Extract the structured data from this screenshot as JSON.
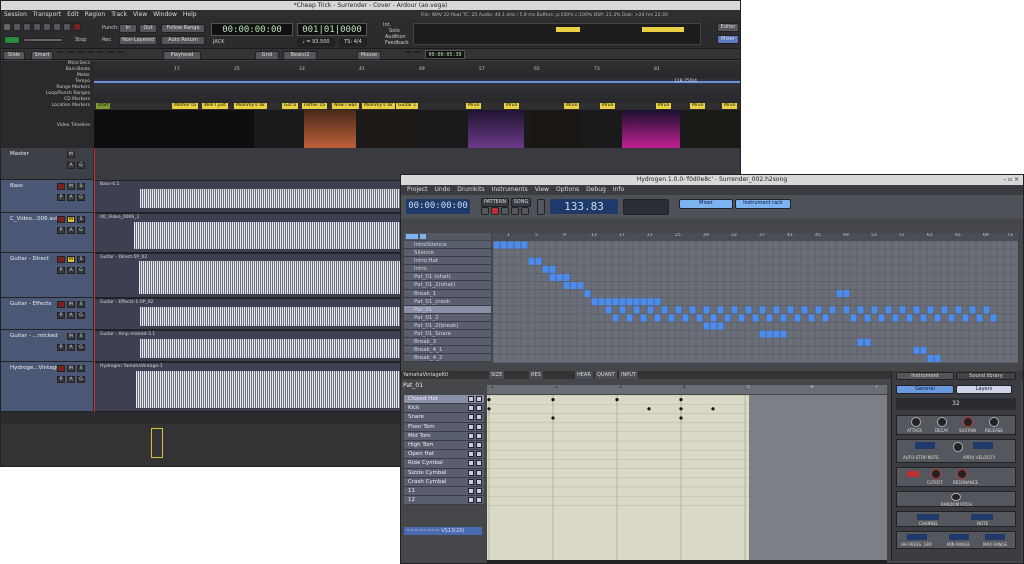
{
  "ardour": {
    "title": "*Cheap Trick - Surrender - Cover - Ardour (ao.vega)",
    "menu": [
      "Session",
      "Transport",
      "Edit",
      "Region",
      "Track",
      "View",
      "Window",
      "Help"
    ],
    "transport": {
      "punch_label": "Punch:",
      "in": "In",
      "out": "Out",
      "follow_range": "Follow Range",
      "auto_return": "Auto Return",
      "stop": "Stop",
      "rec": "Rec",
      "non_layered": "Non-Layered",
      "primary_clock": "00:00:00:00",
      "secondary_clock": "001|01|0000",
      "jack": "JACK",
      "tempo": "♩ = 93.500",
      "ts": "TS: 4/4",
      "int": "Int.",
      "solo": "Solo",
      "audition": "Audition",
      "feedback": "Feedback",
      "editor": "Editor",
      "mixer": "Mixer",
      "mini_clock": "00:00:05:30",
      "status": "File: WAV 32-float   TC: 25   Audio: 44.1 kHz / 5.8 ms   Buffers: p:100% c:100%   DSP: 21.3%   Disk: >24 hrs   22:30"
    },
    "edit_bar": {
      "slide": "Slide",
      "smart": "Smart",
      "playhead": "Playhead",
      "grid": "Grid",
      "beats": "Beats/2",
      "mouse": "Mouse"
    },
    "ruler_labels": [
      "Mins:Secs",
      "Bars:Beats",
      "Meter",
      "Tempo",
      "Range Markers",
      "Loop/Punch Ranges",
      "CD Markers",
      "Location Markers"
    ],
    "video_label": "Video Timeline",
    "tempo_marker": "118.750/4",
    "bar_numbers": [
      "17",
      "25",
      "33",
      "41",
      "49",
      "57",
      "65",
      "73",
      "81"
    ],
    "location_markers": [
      "start",
      "Mother ta",
      "Well I just",
      "Mommy's alr",
      "Got b",
      "Father ca",
      "Now I was",
      "Mommy's alr",
      "Guitar 1",
      "Mrun",
      "Mrun",
      "Mrun",
      "Mrun",
      "Mrun",
      "Mrun",
      "Mrun"
    ],
    "tracks": [
      {
        "name": "Master",
        "region": ""
      },
      {
        "name": "Bass",
        "region": "Bass-4.1"
      },
      {
        "name": "C_Video...006.avi",
        "region": "00_Video_0006_1"
      },
      {
        "name": "Guitar - Direct",
        "region": "Guitar - Direct-5P_02"
      },
      {
        "name": "Guitar - Effects",
        "region": "Guitar - Effects-1-0P_02"
      },
      {
        "name": "Guitar - ...micked",
        "region": "Guitar - Amp micked-3.1"
      },
      {
        "name": "Hydroge...Vintage",
        "region": "Hydrogen YamahaVintage-1"
      }
    ]
  },
  "hydrogen": {
    "title": "Hydrogen 1.0.0-'f0d0e8c' - Surrender_002.h2song",
    "menu": [
      "Project",
      "Undo",
      "Drumkits",
      "Instruments",
      "View",
      "Options",
      "Debug",
      "Info"
    ],
    "clock": "00:00:00:00",
    "bpm": "133.83",
    "mixer": "Mixer",
    "instrument_rack": "Instrument rack",
    "pattern_mode": "PATTERN",
    "song_mode": "SONG",
    "song_patterns": [
      "IntroSilence",
      "Silence",
      "Intro.Hat",
      "Intro",
      "Pat_01 (ohat)",
      "Pat_01_2(ohat)",
      "Break_1",
      "Pat_01_crash",
      "Pat_01",
      "Pat_01_2",
      "Pat_01_2(break)",
      "Pat_01_Snare",
      "Break_3",
      "Break_4_1",
      "Break_4_2"
    ],
    "timeline_numbers": [
      "1",
      "5",
      "9",
      "13",
      "17",
      "21",
      "25",
      "29",
      "33",
      "37",
      "41",
      "45",
      "49",
      "53",
      "57",
      "61",
      "65",
      "69",
      "73"
    ],
    "drumkit": "YamahaVintageKit",
    "pattern_name": "Pat_01",
    "pattern_opts": {
      "size": "SIZE",
      "res": "RES",
      "hear": "HEAR",
      "quant": "QUANT",
      "input": "INPUT"
    },
    "instruments": [
      "Closed Hat",
      "Kick",
      "Snare",
      "Floor Tom",
      "Mid Tom",
      "High Tom",
      "Open Hat",
      "Ride Cymbal",
      "Sizzle Cymbal",
      "Crash Cymbal",
      "11",
      "12"
    ],
    "pattern_beats": [
      "1",
      "2",
      "3",
      "4",
      "5",
      "6",
      "7"
    ],
    "sidebar": {
      "instrument_tab": "Instrument",
      "sound_library_tab": "Sound library",
      "general": "General",
      "layers": "Layers",
      "number": "32",
      "attack": "ATTACK",
      "decay": "DECAY",
      "sustain": "SUSTAIN",
      "release": "RELEASE",
      "auto_stop": "AUTO-STOP NOTE",
      "apply_velocity": "APPLY VELOCITY",
      "cutoff": "CUTOFF",
      "resonance": "RESONANCE",
      "random_pitch": "RANDOM PITCH",
      "channel": "CHANNEL",
      "note": "NOTE",
      "hh_press_grp": "HH PRESS. GRP",
      "min_range": "MIN RANGE",
      "max_range": "MAX RANGE"
    },
    "bottom_input": "~~~~~~~~ VS13(20)"
  },
  "colors": {
    "ardour_bg": "#3a3a3c",
    "track_header": "#4a5775",
    "region_bg": "#3c4050",
    "wave": "#e8e8e8",
    "hydro_pattern_on": "#4a8cf0",
    "hydro_pattern_off": "#6a6e78",
    "drum_grid": "#d9d9c6",
    "marker_yellow": "#e8d040",
    "record_red": "#c03030"
  }
}
